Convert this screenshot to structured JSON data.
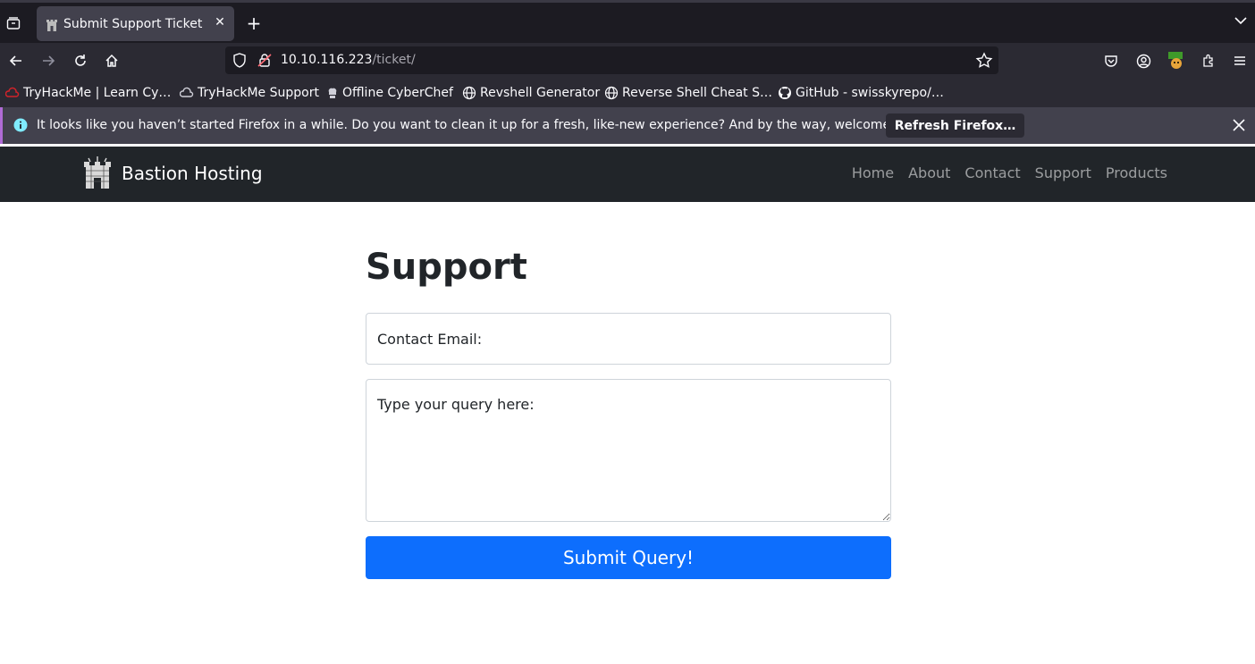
{
  "browser": {
    "tab": {
      "title": "Submit Support Ticket",
      "close": "✕"
    },
    "new_tab": "+",
    "url": {
      "host": "10.10.116.223",
      "path": "/ticket/"
    },
    "bookmarks": [
      {
        "label": "TryHackMe | Learn Cy…",
        "icon": "tryhackme-icon"
      },
      {
        "label": "TryHackMe Support",
        "icon": "cloud-icon"
      },
      {
        "label": "Offline CyberChef",
        "icon": "chef-icon"
      },
      {
        "label": "Revshell Generator",
        "icon": "globe-icon"
      },
      {
        "label": "Reverse Shell Cheat S…",
        "icon": "globe-icon"
      },
      {
        "label": "GitHub - swisskyrepo/…",
        "icon": "github-icon"
      }
    ],
    "infobar": {
      "message": "It looks like you haven’t started Firefox in a while. Do you want to clean it up for a fresh, like-new experience? And by the way, welcome back!",
      "button": "Refresh Firefox…"
    }
  },
  "site": {
    "brand": "Bastion Hosting",
    "nav": [
      "Home",
      "About",
      "Contact",
      "Support",
      "Products"
    ]
  },
  "main": {
    "heading": "Support",
    "email_placeholder": "Contact Email:",
    "query_placeholder": "Type your query here:",
    "submit_label": "Submit Query!"
  },
  "colors": {
    "primary": "#0d6efd",
    "site_nav_bg": "#212529",
    "browser_bg": "#2b2a33"
  }
}
